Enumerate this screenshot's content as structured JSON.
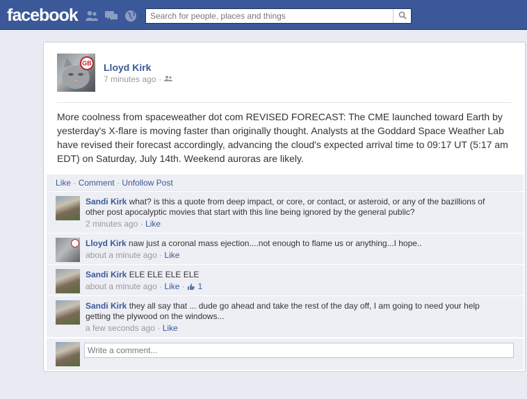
{
  "header": {
    "logo": "facebook",
    "search": {
      "placeholder": "Search for people, places and things"
    }
  },
  "post": {
    "author": "Lloyd Kirk",
    "avatar_badge": "GB",
    "time": "7 minutes ago",
    "separator": "·",
    "text": "More coolness from spaceweather dot com REVISED FORECAST: The CME launched toward Earth by yesterday's X-flare is moving faster than originally thought. Analysts at the Goddard Space Weather Lab have revised their forecast accordingly, advancing the cloud's expected arrival time to 09:17 UT (5:17 am EDT) on Saturday, July 14th. Weekend auroras are likely.",
    "actions": {
      "like": "Like",
      "comment": "Comment",
      "unfollow": "Unfollow Post",
      "sep": "·"
    }
  },
  "comments": [
    {
      "name": "Sandi Kirk",
      "text": "what? is this a quote from deep impact, or core, or contact, or asteroid, or any of the bazillions of other post apocalyptic movies that start with this line being ignored by the general public?",
      "time": "2 minutes ago",
      "like": "Like",
      "likes_count": ""
    },
    {
      "name": "Lloyd Kirk",
      "text": "naw just a coronal mass ejection....not enough to flame us or anything...I hope..",
      "time": "about a minute ago",
      "like": "Like",
      "likes_count": ""
    },
    {
      "name": "Sandi Kirk",
      "text": "ELE ELE ELE ELE",
      "time": "about a minute ago",
      "like": "Like",
      "likes_count": "1"
    },
    {
      "name": "Sandi Kirk",
      "text": "they all say that ... dude go ahead and take the rest of the day off, I am going to need your help getting the plywood on the windows...",
      "time": "a few seconds ago",
      "like": "Like",
      "likes_count": ""
    }
  ],
  "write_comment": {
    "placeholder": "Write a comment..."
  },
  "colors": {
    "brand": "#3b5998",
    "comment_bg": "#edeff4",
    "page_bg": "#e9ebf2"
  },
  "icons": [
    "friends-icon",
    "messages-icon",
    "notifications-globe-icon",
    "search-icon",
    "audience-friends-icon",
    "like-thumb-icon"
  ]
}
